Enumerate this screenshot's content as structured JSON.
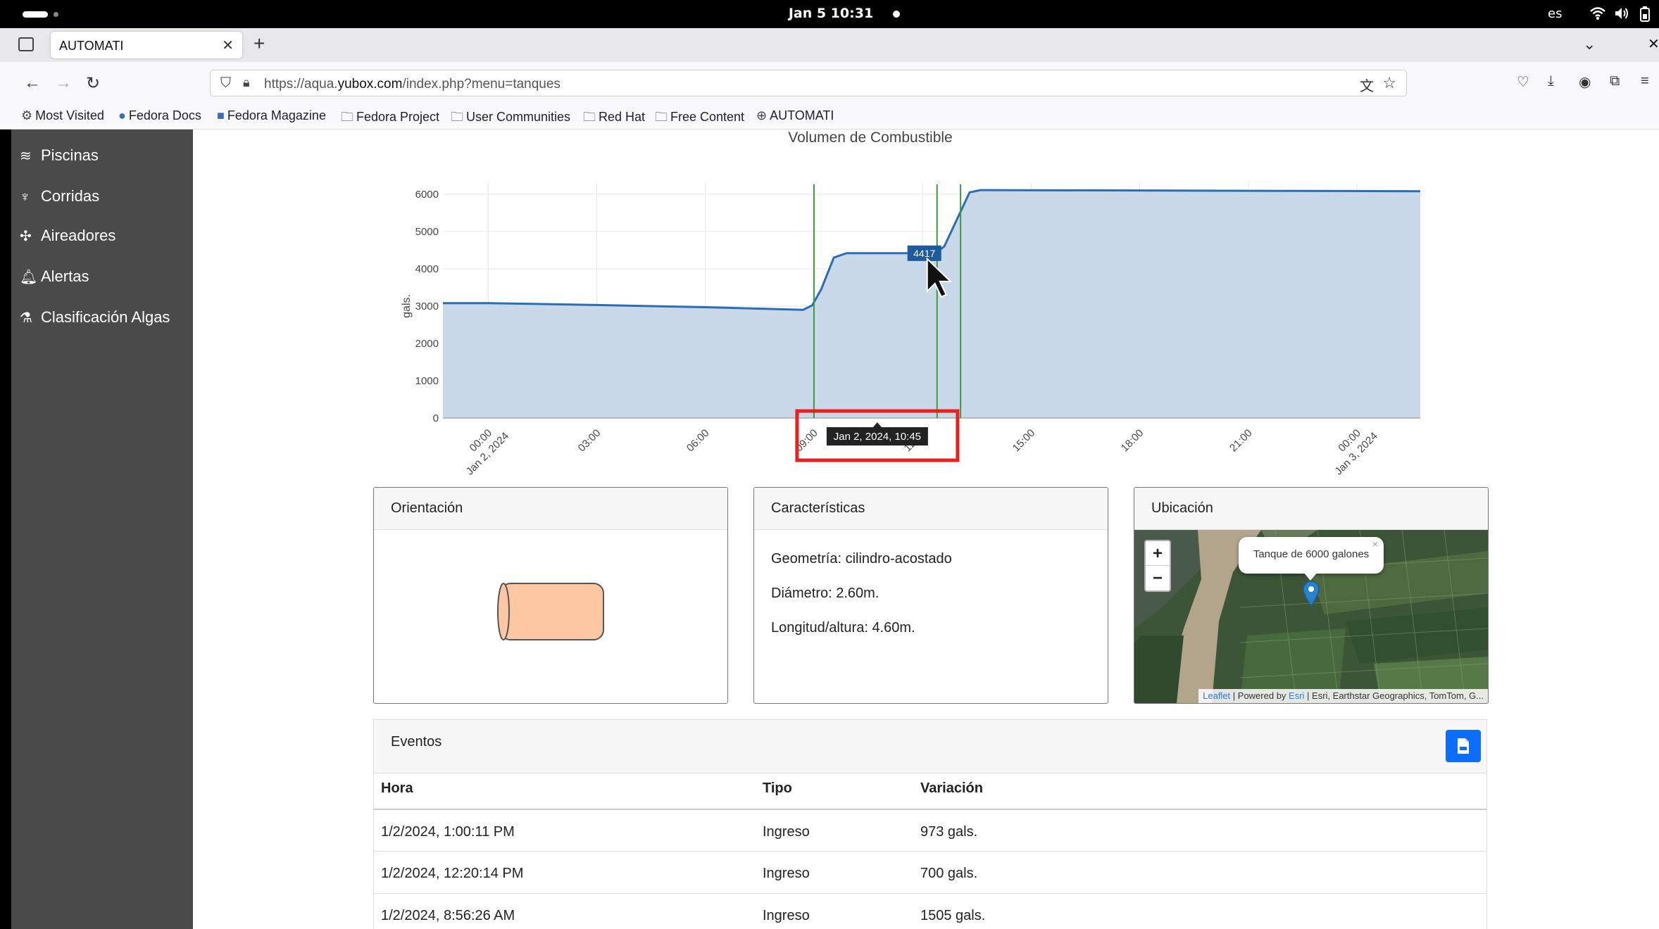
{
  "system": {
    "clock": "Jan 5  10:31",
    "language": "es"
  },
  "browser": {
    "tab_title": "AUTOMATI",
    "url_prefix": "https://aqua.",
    "url_domain": "yubox.com",
    "url_path": "/index.php?menu=tanques",
    "bookmarks": [
      "Most Visited",
      "Fedora Docs",
      "Fedora Magazine",
      "Fedora Project",
      "User Communities",
      "Red Hat",
      "Free Content",
      "AUTOMATI"
    ]
  },
  "sidebar": {
    "items": [
      {
        "label": "Piscinas",
        "icon": "waves-icon"
      },
      {
        "label": "Corridas",
        "icon": "shrimp-icon"
      },
      {
        "label": "Aireadores",
        "icon": "fan-icon"
      },
      {
        "label": "Alertas",
        "icon": "bell-icon"
      },
      {
        "label": "Clasificación Algas",
        "icon": "microscope-icon"
      }
    ]
  },
  "chart_data": {
    "type": "area",
    "title": "Volumen de Combustible",
    "ylabel": "gals.",
    "ylim": [
      0,
      6300
    ],
    "yticks": [
      0,
      1000,
      2000,
      3000,
      4000,
      5000,
      6000
    ],
    "x_ticks": [
      {
        "t": 0,
        "label": [
          "00:00",
          "Jan 2, 2024"
        ]
      },
      {
        "t": 3,
        "label": [
          "03:00"
        ]
      },
      {
        "t": 6,
        "label": [
          "06:00"
        ]
      },
      {
        "t": 9,
        "label": [
          "09:00"
        ]
      },
      {
        "t": 12,
        "label": [
          "12:00"
        ]
      },
      {
        "t": 15,
        "label": [
          "15:00"
        ]
      },
      {
        "t": 18,
        "label": [
          "18:00"
        ]
      },
      {
        "t": 21,
        "label": [
          "21:00"
        ]
      },
      {
        "t": 24,
        "label": [
          "00:00",
          "Jan 3, 2024"
        ]
      }
    ],
    "x_range": [
      -1.25,
      25.75
    ],
    "points": [
      {
        "x": -1.25,
        "y": 3080
      },
      {
        "x": 0,
        "y": 3080
      },
      {
        "x": 3,
        "y": 3030
      },
      {
        "x": 6,
        "y": 2970
      },
      {
        "x": 8.7,
        "y": 2900
      },
      {
        "x": 8.95,
        "y": 3020
      },
      {
        "x": 9.2,
        "y": 3450
      },
      {
        "x": 9.55,
        "y": 4300
      },
      {
        "x": 9.9,
        "y": 4420
      },
      {
        "x": 12.35,
        "y": 4417
      },
      {
        "x": 12.6,
        "y": 4600
      },
      {
        "x": 13.3,
        "y": 6050
      },
      {
        "x": 13.6,
        "y": 6110
      },
      {
        "x": 25.75,
        "y": 6080
      }
    ],
    "event_lines_x": [
      9.0,
      12.4,
      13.05
    ],
    "hover_value": "4417",
    "hover_time": "Jan 2, 2024, 10:45",
    "fill_color": "#c9d9ea",
    "line_color": "#2e6db1",
    "event_color": "#3a9a3a",
    "highlight_color": "#e82020"
  },
  "cards": {
    "orientation": {
      "title": "Orientación"
    },
    "features": {
      "title": "Características",
      "geometry": "Geometría: cilindro-acostado",
      "diameter": "Diámetro: 2.60m.",
      "length": "Longitud/altura: 4.60m."
    },
    "location": {
      "title": "Ubicación",
      "zoom_in": "+",
      "zoom_out": "−",
      "popup": "Tanque de 6000 galones",
      "popup_close": "×",
      "attrib_leaflet": "Leaflet",
      "attrib_powered": " | Powered by ",
      "attrib_esri": "Esri",
      "attrib_rest": " | Esri, Earthstar Geographics, TomTom, G..."
    }
  },
  "events": {
    "title": "Eventos",
    "headers": [
      "Hora",
      "Tipo",
      "Variación"
    ],
    "rows": [
      [
        "1/2/2024, 1:00:11 PM",
        "Ingreso",
        "973 gals."
      ],
      [
        "1/2/2024, 12:20:14 PM",
        "Ingreso",
        "700 gals."
      ],
      [
        "1/2/2024, 8:56:26 AM",
        "Ingreso",
        "1505 gals."
      ]
    ]
  }
}
